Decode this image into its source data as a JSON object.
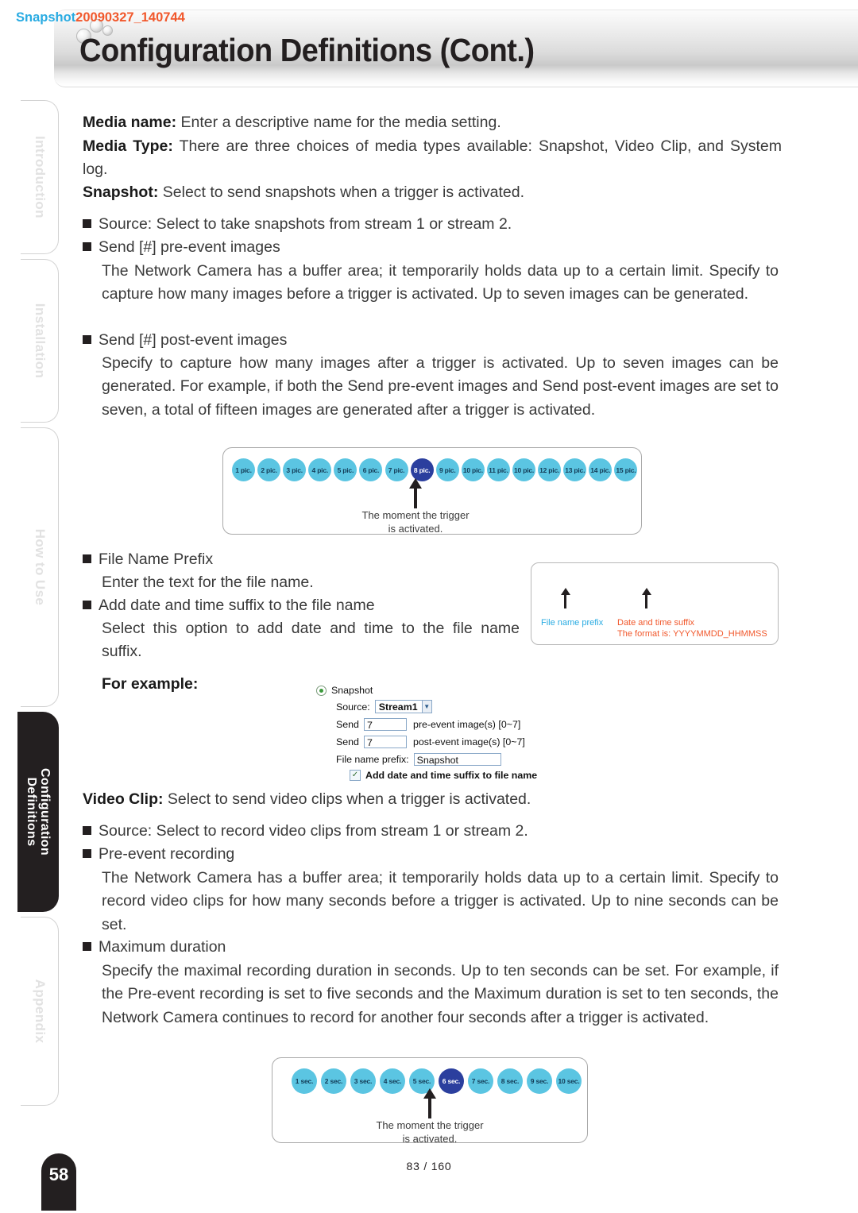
{
  "header": {
    "title": "Configuration Definitions (Cont.)"
  },
  "sidebar": {
    "items": [
      {
        "label": "Introduction",
        "active": false
      },
      {
        "label": "Installation",
        "active": false
      },
      {
        "label": "How to Use",
        "active": false
      },
      {
        "label": "Configuration",
        "label2": "Definitions",
        "active": true
      },
      {
        "label": "Appendix",
        "active": false
      }
    ]
  },
  "body": {
    "media_name_label": "Media name:",
    "media_name_text": " Enter a descriptive name for the media setting.",
    "media_type_label": "Media Type:",
    "media_type_text": " There are three choices of media types available: Snapshot, Video Clip, and System log.",
    "snapshot_label": "Snapshot:",
    "snapshot_text": " Select to send snapshots when a trigger is activated.",
    "b1_text": "Source: Select to take snapshots from stream 1 or stream 2.",
    "b2_text": "Send [#] pre-event images",
    "b2_body": "The Network Camera has a buffer area; it temporarily holds data up to a certain limit. Specify to capture how many images before a trigger is activated. Up to seven images can be generated.",
    "b3_text": "Send [#] post-event images",
    "b3_body": "Specify to capture how many images after a trigger is activated. Up to seven images can be generated. For example, if both the Send pre-event images and Send post-event images are set to seven, a total of fifteen images are generated after a trigger is activated.",
    "b4_text": "File Name Prefix",
    "b4_body": "Enter the text for the file name.",
    "b5_text": "Add date and time suffix to the file name",
    "b5_body": "Select this option to add date and time to the file name suffix.",
    "for_example": "For example:",
    "video_clip_label": "Video Clip:",
    "video_clip_text": " Select to send video clips when a trigger is activated.",
    "b6_text": "Source: Select to record video clips from stream 1 or stream 2.",
    "b7_text": "Pre-event recording",
    "b7_body": "The Network Camera has a buffer area; it temporarily holds data up to a certain limit. Specify to record video clips for how many seconds before a trigger is activated. Up to nine seconds can be set.",
    "b8_text": "Maximum duration",
    "b8_body": "Specify the maximal recording duration in seconds. Up to ten seconds can be set. For example, if the Pre-event recording is set to five seconds and the Maximum duration is set to ten seconds, the Network Camera continues to record for another four seconds after a trigger is activated."
  },
  "diagram_pictures": {
    "bubbles": [
      "1 pic.",
      "2 pic.",
      "3 pic.",
      "4 pic.",
      "5 pic.",
      "6 pic.",
      "7 pic.",
      "8 pic.",
      "9 pic.",
      "10 pic.",
      "11 pic.",
      "10 pic.",
      "12 pic.",
      "13 pic.",
      "14 pic.",
      "15 pic."
    ],
    "highlight_index": 7,
    "caption_line1": "The moment the trigger",
    "caption_line2": "is activated.",
    "bubble_color": "#5bc5e2",
    "highlight_color": "#2b3f9e"
  },
  "diagram_seconds": {
    "bubbles": [
      "1 sec.",
      "2 sec.",
      "3 sec.",
      "4 sec.",
      "5 sec.",
      "6 sec.",
      "7 sec.",
      "8 sec.",
      "9 sec.",
      "10 sec."
    ],
    "highlight_index": 5,
    "caption_line1": "The moment the trigger",
    "caption_line2": "is activated.",
    "bubble_color": "#5bc5e2",
    "highlight_color": "#2b3f9e"
  },
  "callout": {
    "prefix": "Snapshot",
    "suffix": "20090327_140744",
    "prefix_color": "#29abe2",
    "suffix_color": "#f1582c",
    "label_prefix": "File name prefix",
    "label_suffix": "Date and time suffix",
    "label_format": "The format is: YYYYMMDD_HHMMSS"
  },
  "form": {
    "radio_label": "Snapshot",
    "source_label": "Source:",
    "source_value": "Stream1",
    "send_label_1": "Send",
    "send_value_1": "7",
    "send_unit_1": "pre-event image(s) [0~7]",
    "send_label_2": "Send",
    "send_value_2": "7",
    "send_unit_2": "post-event image(s) [0~7]",
    "prefix_label": "File name prefix:",
    "prefix_value": "Snapshot",
    "checkbox_label": "Add date and time suffix to file name",
    "checkbox_glyph": "✓"
  },
  "footer": {
    "page_badge": "58",
    "page_numbers": "83 / 160"
  }
}
